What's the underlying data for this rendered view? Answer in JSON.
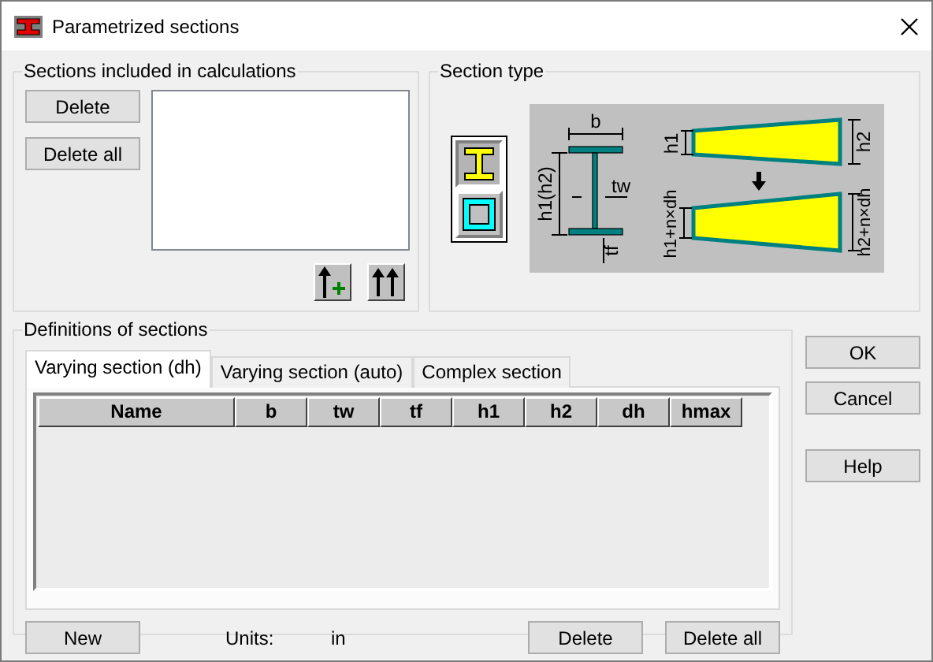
{
  "window": {
    "title": "Parametrized sections"
  },
  "included": {
    "title": "Sections included in calculations",
    "buttons": [
      "Delete",
      "Delete all"
    ]
  },
  "section_type": {
    "title": "Section type",
    "types": [
      {
        "kind": "i-beam",
        "selected": true
      },
      {
        "kind": "box",
        "selected": false
      }
    ],
    "diagram_labels": {
      "width": "b",
      "height": "h1(h2)",
      "web": "tw",
      "flange": "tf",
      "start_height": "h1",
      "end_height": "h2",
      "start_result": "h1+n×dh",
      "end_result": "h2+n×dh"
    }
  },
  "definitions": {
    "title": "Definitions of sections",
    "tabs": [
      {
        "label": "Varying section (dh)",
        "selected": true
      },
      {
        "label": "Varying section (auto)",
        "selected": false
      },
      {
        "label": "Complex section",
        "selected": false
      }
    ],
    "table": {
      "columns": [
        "Name",
        "b",
        "tw",
        "tf",
        "h1",
        "h2",
        "dh",
        "hmax"
      ]
    },
    "new_button": "New",
    "units_label": "Units:",
    "units_value": "in",
    "delete_buttons": [
      "Delete",
      "Delete all"
    ]
  },
  "dialog_buttons": [
    "OK",
    "Cancel",
    "Help"
  ]
}
